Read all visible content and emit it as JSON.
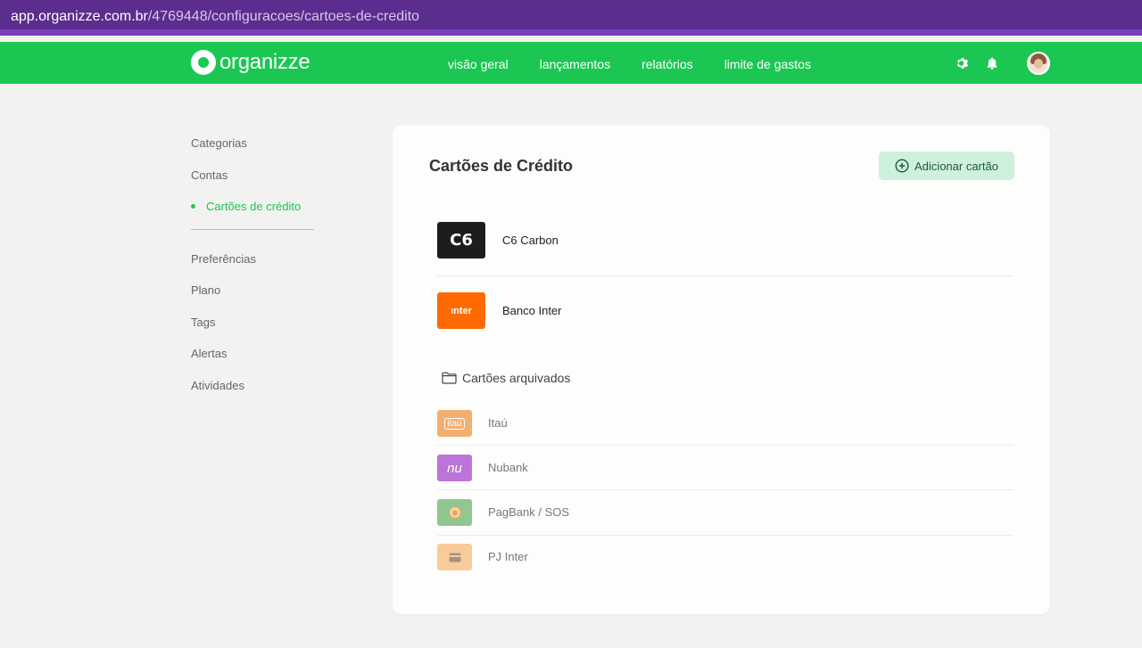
{
  "browser": {
    "url_host": "app.organizze.com.br",
    "url_path": "/4769448/configuracoes/cartoes-de-credito"
  },
  "header": {
    "logo_text": "organizze",
    "nav": [
      "visão geral",
      "lançamentos",
      "relatórios",
      "limite de gastos"
    ]
  },
  "sidebar": {
    "items": [
      "Categorias",
      "Contas",
      "Cartões de crédito"
    ],
    "items2": [
      "Preferências",
      "Plano",
      "Tags",
      "Alertas",
      "Atividades"
    ]
  },
  "main": {
    "title": "Cartões de Crédito",
    "add_button": "Adicionar cartão",
    "cards": [
      {
        "name": "C6 Carbon",
        "logo_text": "C6",
        "logo_color": "#1d1d1d"
      },
      {
        "name": "Banco Inter",
        "logo_text": "ınter",
        "logo_color": "#ff6a00"
      }
    ],
    "archived_label": "Cartões arquivados",
    "archived": [
      {
        "name": "Itaú",
        "logo_text": "itaú",
        "logo_color": "#ec7000"
      },
      {
        "name": "Nubank",
        "logo_text": "nu",
        "logo_color": "#8a05be"
      },
      {
        "name": "PagBank / SOS",
        "logo_text": "",
        "logo_color": "#3a9b3a"
      },
      {
        "name": "PJ Inter",
        "logo_text": "",
        "logo_color": "#f7a24b"
      }
    ]
  },
  "colors": {
    "brand_green": "#1bc752",
    "browser_purple": "#5b2d8e",
    "button_bg": "#cdf1dc"
  }
}
